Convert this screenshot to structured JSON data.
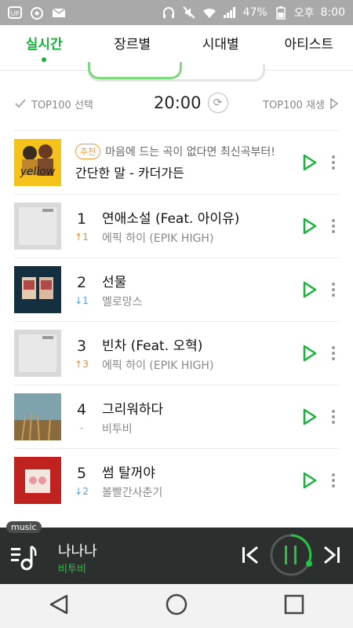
{
  "status": {
    "battery": "47%",
    "ampm": "오후",
    "time": "8:00"
  },
  "tabs": [
    {
      "label": "실시간"
    },
    {
      "label": "장르별"
    },
    {
      "label": "시대별"
    },
    {
      "label": "아티스트"
    }
  ],
  "controls": {
    "select_label": "TOP100 선택",
    "time": "20:00",
    "play_label": "TOP100 재생"
  },
  "recommend": {
    "badge": "추천",
    "text": "마음에 드는 곡이 없다면 최신곡부터!",
    "song": "간단한 말 - 카더가든",
    "thumb_text": "yellow"
  },
  "chart": [
    {
      "rank": "1",
      "change": "↑1",
      "change_color": "#f08a24",
      "title": "연애소설 (Feat. 아이유)",
      "artist": "에픽 하이 (EPIK HIGH)",
      "thumb_color": "#d9d9d9"
    },
    {
      "rank": "2",
      "change": "↓1",
      "change_color": "#4aa8e8",
      "title": "선물",
      "artist": "멜로망스",
      "thumb_color": "#142f3f"
    },
    {
      "rank": "3",
      "change": "↑3",
      "change_color": "#f08a24",
      "title": "빈차 (Feat. 오혁)",
      "artist": "에픽 하이 (EPIK HIGH)",
      "thumb_color": "#d9d9d9"
    },
    {
      "rank": "4",
      "change": "-",
      "change_color": "#999999",
      "title": "그리워하다",
      "artist": "비투비",
      "thumb_color": "#6c8a8a"
    },
    {
      "rank": "5",
      "change": "↓2",
      "change_color": "#4aa8e8",
      "title": "썸 탈꺼야",
      "artist": "볼빨간사춘기",
      "thumb_color": "#c0221f"
    }
  ],
  "player": {
    "label": "music",
    "title": "나나나",
    "artist": "비투비"
  },
  "colors": {
    "accent": "#17b33a",
    "player_bg": "#2b2f2e"
  }
}
